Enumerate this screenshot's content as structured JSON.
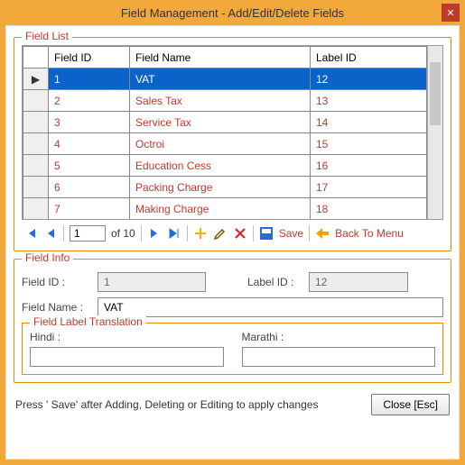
{
  "window": {
    "title": "Field Management - Add/Edit/Delete Fields"
  },
  "fieldList": {
    "title": "Field List",
    "columns": {
      "fieldId": "Field ID",
      "fieldName": "Field Name",
      "labelId": "Label ID"
    },
    "rows": [
      {
        "id": "1",
        "name": "VAT",
        "label": "12",
        "selected": true
      },
      {
        "id": "2",
        "name": "Sales Tax",
        "label": "13"
      },
      {
        "id": "3",
        "name": "Service Tax",
        "label": "14"
      },
      {
        "id": "4",
        "name": "Octroi",
        "label": "15"
      },
      {
        "id": "5",
        "name": "Education Cess",
        "label": "16"
      },
      {
        "id": "6",
        "name": "Packing Charge",
        "label": "17"
      },
      {
        "id": "7",
        "name": "Making Charge",
        "label": "18"
      }
    ],
    "pager": {
      "current": "1",
      "ofText": "of 10",
      "save": "Save",
      "back": "Back To Menu"
    }
  },
  "fieldInfo": {
    "title": "Field Info",
    "fieldIdLabel": "Field ID :",
    "fieldIdValue": "1",
    "labelIdLabel": "Label ID :",
    "labelIdValue": "12",
    "fieldNameLabel": "Field Name :",
    "fieldNameValue": "VAT",
    "translation": {
      "title": "Field Label Translation",
      "hindi": "Hindi :",
      "hindiValue": "",
      "marathi": "Marathi :",
      "marathiValue": ""
    }
  },
  "footer": {
    "hint": "Press '        Save' after Adding, Deleting or Editing to apply changes",
    "close": "Close [Esc]"
  }
}
